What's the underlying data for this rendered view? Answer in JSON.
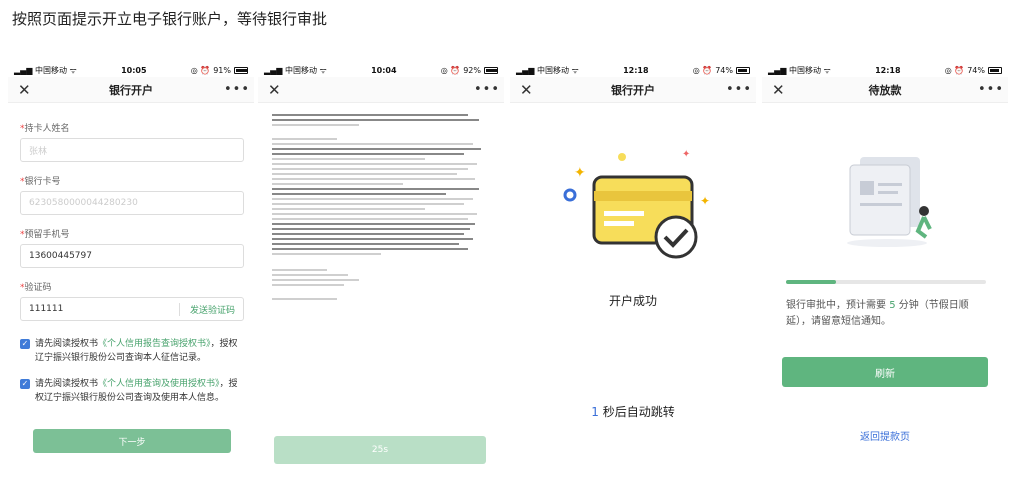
{
  "caption": "按照页面提示开立电子银行账户，等待银行审批",
  "screens": [
    {
      "status": {
        "carrier": "中国移动",
        "time": "10:05",
        "battery": "91%",
        "battery_level": 0.91
      },
      "nav": {
        "close": "✕",
        "title": "银行开户",
        "more": "•••"
      },
      "fields": [
        {
          "label": "持卡人姓名",
          "value": "张林",
          "required": "*"
        },
        {
          "label": "银行卡号",
          "value": "6230580000044280230",
          "required": "*"
        },
        {
          "label": "预留手机号",
          "value": "13600445797",
          "required": "*"
        },
        {
          "label": "验证码",
          "value": "111111",
          "required": "*",
          "action": "发送验证码"
        }
      ],
      "agreements": [
        {
          "prefix": "请先阅读授权书",
          "link": "《个人信用报告查询授权书》",
          "suffix": "，授权辽宁振兴银行股份公司查询本人征信记录。"
        },
        {
          "prefix": "请先阅读授权书",
          "link": "《个人信用查询及使用授权书》",
          "suffix": "，授权辽宁振兴银行股份公司查询及使用本人信息。"
        }
      ],
      "next_button": "下一步"
    },
    {
      "status": {
        "carrier": "中国移动",
        "time": "10:04",
        "battery": "92%",
        "battery_level": 0.92
      },
      "nav": {
        "close": "✕",
        "title": "",
        "more": "•••"
      },
      "countdown_button": "25s"
    },
    {
      "status": {
        "carrier": "中国移动",
        "time": "12:18",
        "battery": "74%",
        "battery_level": 0.74
      },
      "nav": {
        "close": "✕",
        "title": "银行开户",
        "more": "•••"
      },
      "success_text": "开户成功",
      "redirect": {
        "seconds": "1",
        "text": " 秒后自动跳转"
      }
    },
    {
      "status": {
        "carrier": "中国移动",
        "time": "12:18",
        "battery": "74%",
        "battery_level": 0.74
      },
      "nav": {
        "close": "✕",
        "title": "待放款",
        "more": "•••"
      },
      "progress": 0.25,
      "pending": {
        "prefix": "银行审批中，预计需要 ",
        "minutes": "5",
        "suffix": " 分钟（节假日顺延），请留意短信通知。"
      },
      "refresh_button": "刷新",
      "back_link": "返回提款页"
    }
  ],
  "colors": {
    "accent_green": "#5fb57f",
    "link_blue": "#3a6fd8",
    "checkbox_blue": "#3f7bd8",
    "card_yellow": "#f7dd5a"
  }
}
